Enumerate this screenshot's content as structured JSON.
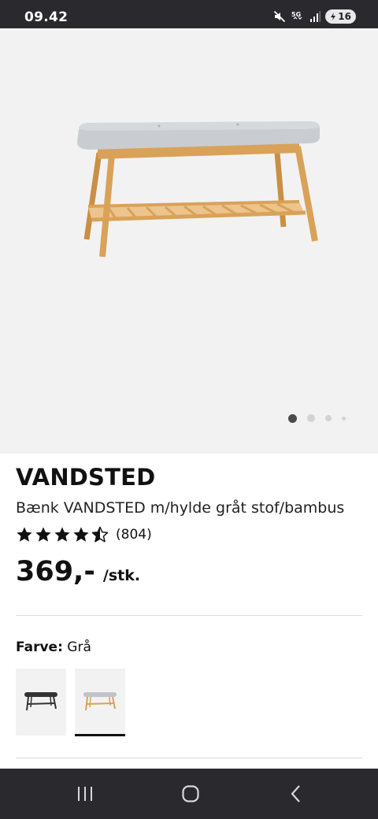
{
  "status_bar": {
    "time": "09.42",
    "network": "5G",
    "battery": "16"
  },
  "gallery": {
    "image_count": 4,
    "active_index": 0
  },
  "product": {
    "name": "VANDSTED",
    "description": "Bænk VANDSTED m/hylde gråt stof/bambus",
    "rating_value": 4.5,
    "rating_max": 5,
    "review_count": "(804)",
    "price": "369,-",
    "unit": "/stk."
  },
  "color_selector": {
    "label": "Farve:",
    "selected": "Grå",
    "options": [
      {
        "color": "#333333",
        "selected": false
      },
      {
        "color": "#bfc4c8",
        "selected": true
      }
    ]
  },
  "colors": {
    "wood": "#d9a259",
    "fabric": "#c9cdd1",
    "status_bar": "#2a2a2e"
  },
  "nav_bar": {
    "icons": [
      "recent-apps-icon",
      "home-icon",
      "back-icon"
    ]
  }
}
